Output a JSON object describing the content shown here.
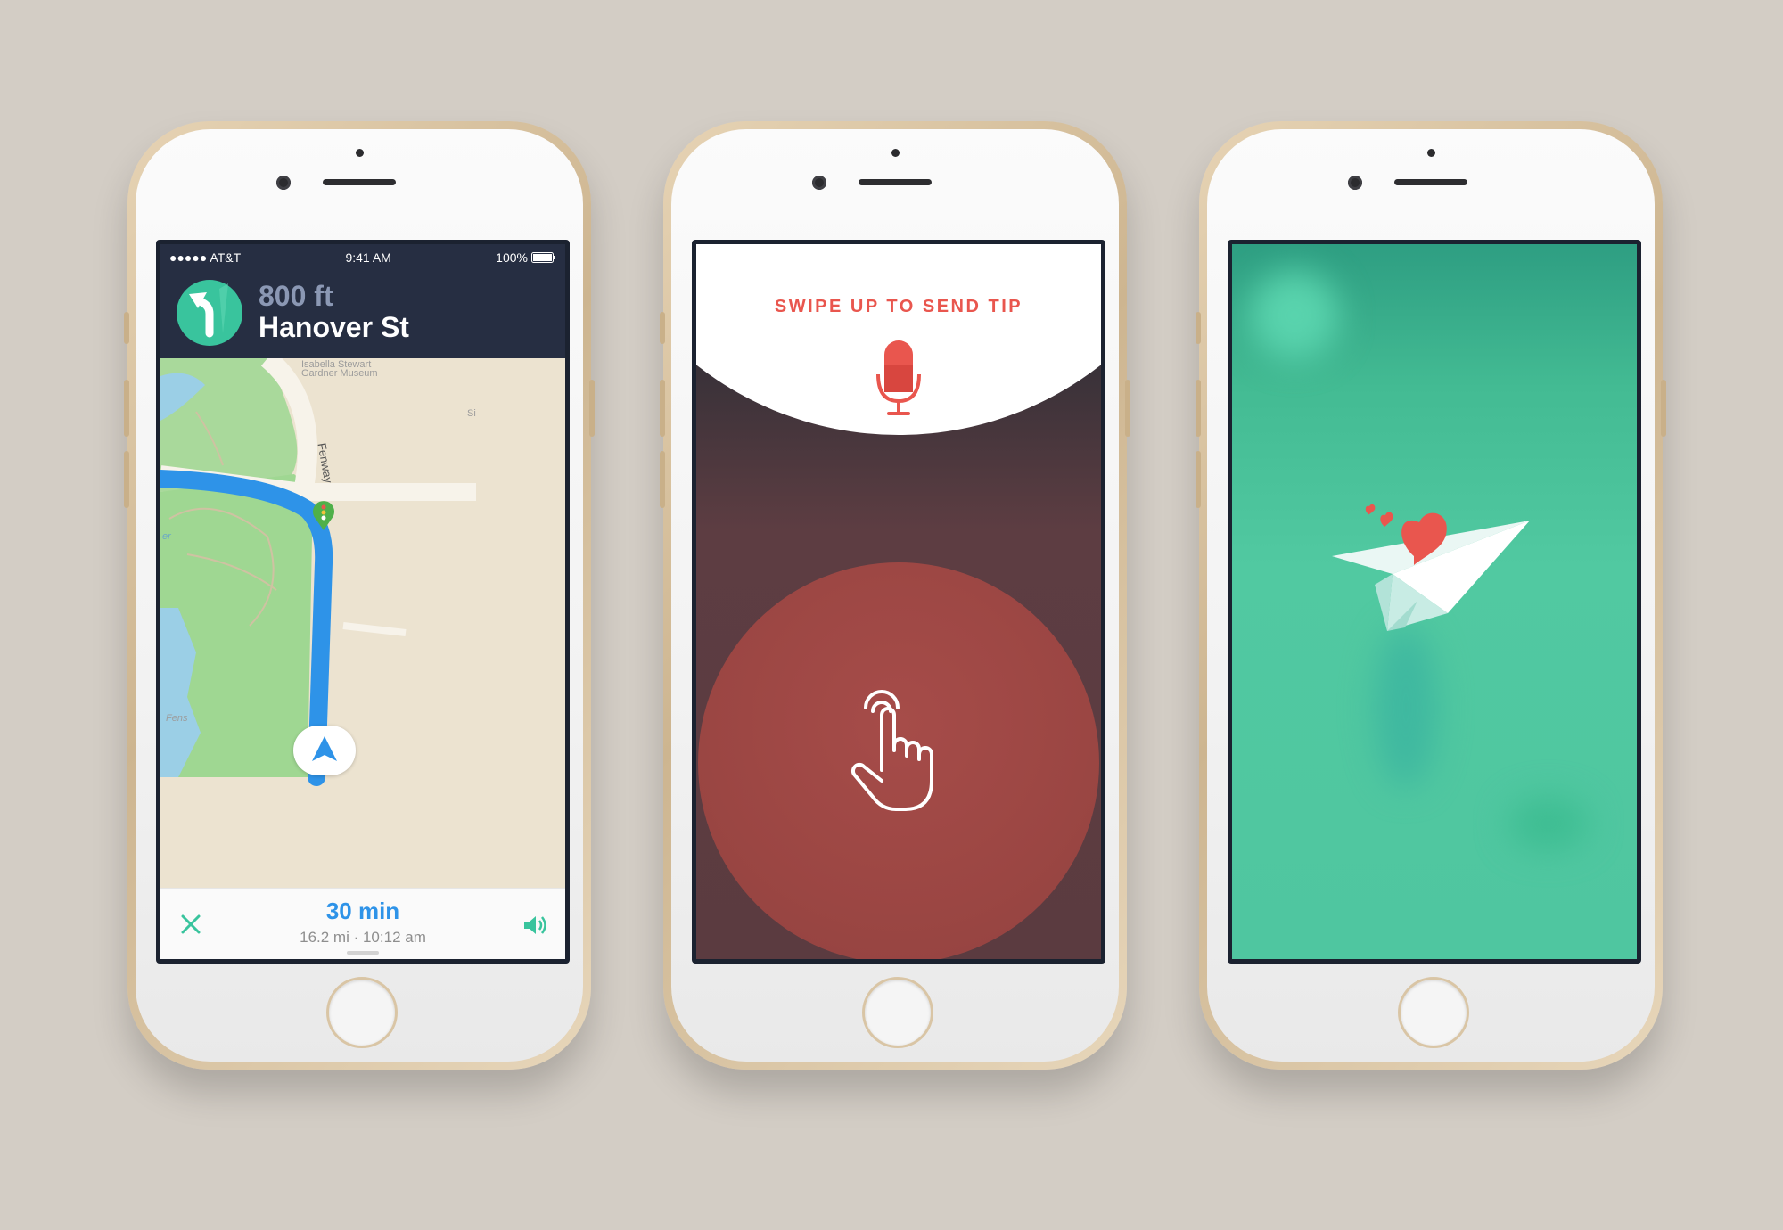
{
  "phone1": {
    "status": {
      "carrier": "●●●●● AT&T",
      "time": "9:41 AM",
      "battery": "100%"
    },
    "maneuver": {
      "icon": "turn-left-arrow-icon",
      "distance": "800 ft",
      "street": "Hanover St"
    },
    "map": {
      "labels": [
        "Isabella Stewart",
        "Gardner Museum",
        "Fenway",
        "Fens",
        "Si",
        "er"
      ]
    },
    "footer": {
      "eta": "30 min",
      "details": "16.2 mi · 10:12 am"
    },
    "colors": {
      "header": "#262e42",
      "accent": "#39c49d",
      "route": "#2e93e8"
    }
  },
  "phone2": {
    "prompt": "SWIPE UP TO SEND TIP",
    "icons": [
      "microphone-icon",
      "hand-pointer-icon"
    ],
    "colors": {
      "accent": "#e9564e",
      "circle": "#9b4643"
    }
  },
  "phone3": {
    "icons": [
      "paper-plane-icon",
      "heart-icon"
    ],
    "colors": {
      "background": "#4fc6a0",
      "heart": "#e9564e"
    }
  }
}
